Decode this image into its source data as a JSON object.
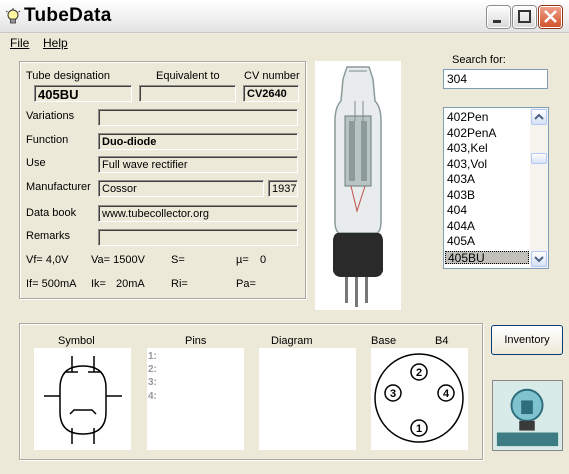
{
  "window": {
    "title": "TubeData"
  },
  "menu": {
    "file": "File",
    "help": "Help"
  },
  "details": {
    "tube_designation_label": "Tube designation",
    "tube_designation": "405BU",
    "equivalent_label": "Equivalent to",
    "equivalent": "",
    "cv_label": "CV number",
    "cv": "CV2640",
    "variations_label": "Variations",
    "variations": "",
    "function_label": "Function",
    "function": "Duo-diode",
    "use_label": "Use",
    "use": "Full wave rectifier",
    "manufacturer_label": "Manufacturer",
    "manufacturer": "Cossor",
    "year": "1937",
    "databook_label": "Data book",
    "databook": "www.tubecollector.org",
    "remarks_label": "Remarks",
    "remarks": "",
    "vf": "Vf= 4,0V",
    "va": "Va= 1500V",
    "s": "S=",
    "mu": "µ=",
    "mu_value": "0",
    "if": "If= 500mA",
    "ik": "Ik=",
    "ik_value": "20mA",
    "ri": "Ri=",
    "pa": "Pa="
  },
  "search": {
    "label": "Search for:",
    "value": "304"
  },
  "list": {
    "items": [
      "402Pen",
      "402PenA",
      "403,Kel",
      "403,Vol",
      "403A",
      "403B",
      "404",
      "404A",
      "405A",
      "405BU"
    ],
    "selected": "405BU"
  },
  "bottom": {
    "symbol_label": "Symbol",
    "pins_label": "Pins",
    "diagram_label": "Diagram",
    "base_label": "Base",
    "base_type": "B4",
    "pins": [
      "1:",
      "2:",
      "3:",
      "4:"
    ],
    "base_pins": [
      "1",
      "2",
      "3",
      "4"
    ]
  },
  "inventory_button": "Inventory"
}
